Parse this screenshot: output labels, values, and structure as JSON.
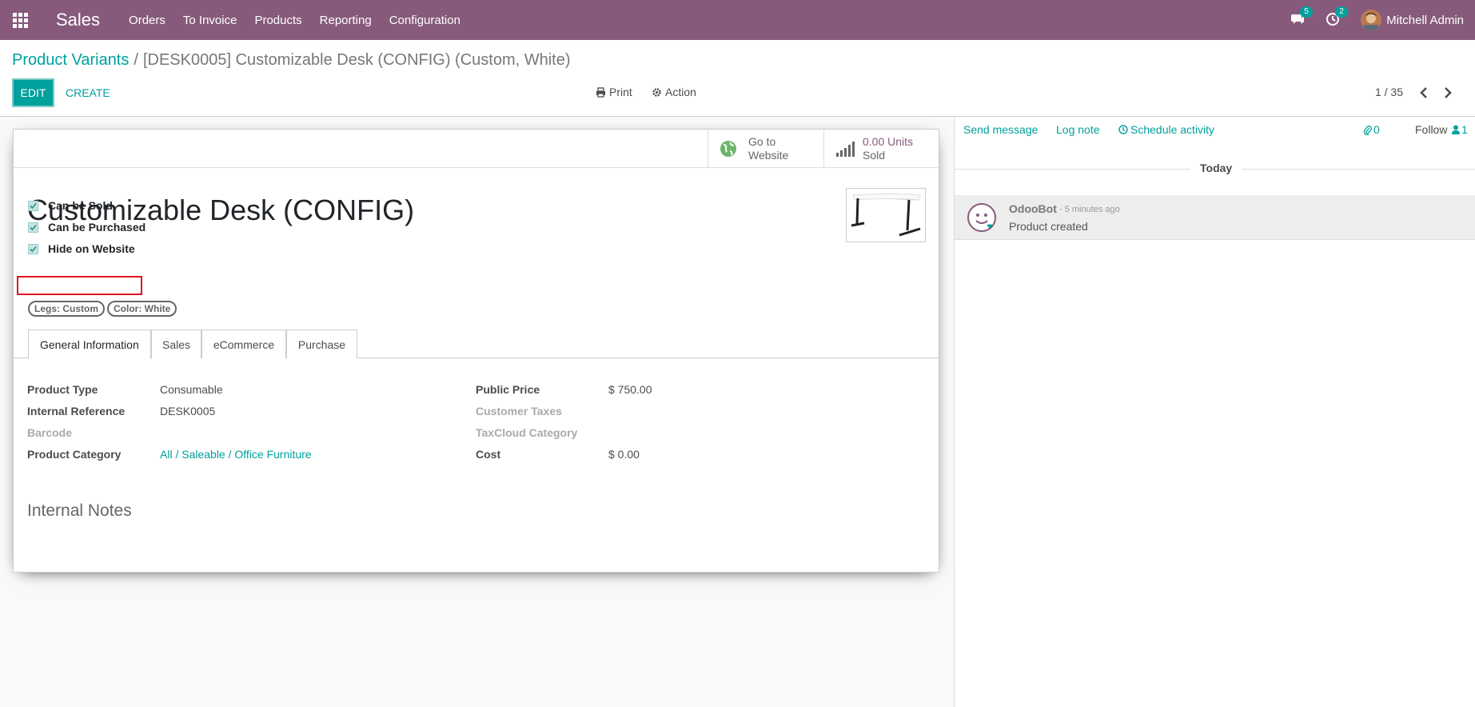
{
  "navbar": {
    "app_name": "Sales",
    "menu": [
      "Orders",
      "To Invoice",
      "Products",
      "Reporting",
      "Configuration"
    ],
    "messages_count": "5",
    "activities_count": "2",
    "user_name": "Mitchell Admin"
  },
  "breadcrumb": {
    "parent": "Product Variants",
    "separator": "/",
    "current": "[DESK0005] Customizable Desk (CONFIG) (Custom, White)"
  },
  "toolbar": {
    "edit_label": "EDIT",
    "create_label": "CREATE",
    "print_label": "Print",
    "action_label": "Action",
    "pager": "1 / 35"
  },
  "stat_buttons": {
    "website_line1": "Go to",
    "website_line2": "Website",
    "sold_value": "0.00 Units",
    "sold_label": "Sold"
  },
  "form": {
    "title": "Customizable Desk (CONFIG)",
    "checkboxes": [
      {
        "label": "Can be Sold",
        "checked": true
      },
      {
        "label": "Can be Purchased",
        "checked": true
      },
      {
        "label": "Hide on Website",
        "checked": true
      }
    ],
    "tags": [
      "Legs: Custom",
      "Color: White"
    ],
    "tabs": [
      "General Information",
      "Sales",
      "eCommerce",
      "Purchase"
    ],
    "left_fields": [
      {
        "label": "Product Type",
        "value": "Consumable"
      },
      {
        "label": "Internal Reference",
        "value": "DESK0005"
      },
      {
        "label": "Barcode",
        "value": ""
      },
      {
        "label": "Product Category",
        "value": "All / Saleable / Office Furniture"
      }
    ],
    "right_fields": [
      {
        "label": "Public Price",
        "value": "$ 750.00"
      },
      {
        "label": "Customer Taxes",
        "value": ""
      },
      {
        "label": "TaxCloud Category",
        "value": ""
      },
      {
        "label": "Cost",
        "value": "$ 0.00"
      }
    ],
    "notes_title": "Internal Notes"
  },
  "chatter": {
    "send_message": "Send message",
    "log_note": "Log note",
    "schedule_activity": "Schedule activity",
    "attachments_count": "0",
    "follow": "Follow",
    "followers_count": "1",
    "today": "Today",
    "message": {
      "author": "OdooBot",
      "time": "- 5 minutes ago",
      "body": "Product created"
    }
  },
  "colors": {
    "brand": "#875a7b",
    "accent": "#00a09d",
    "highlight": "#e0141e"
  }
}
